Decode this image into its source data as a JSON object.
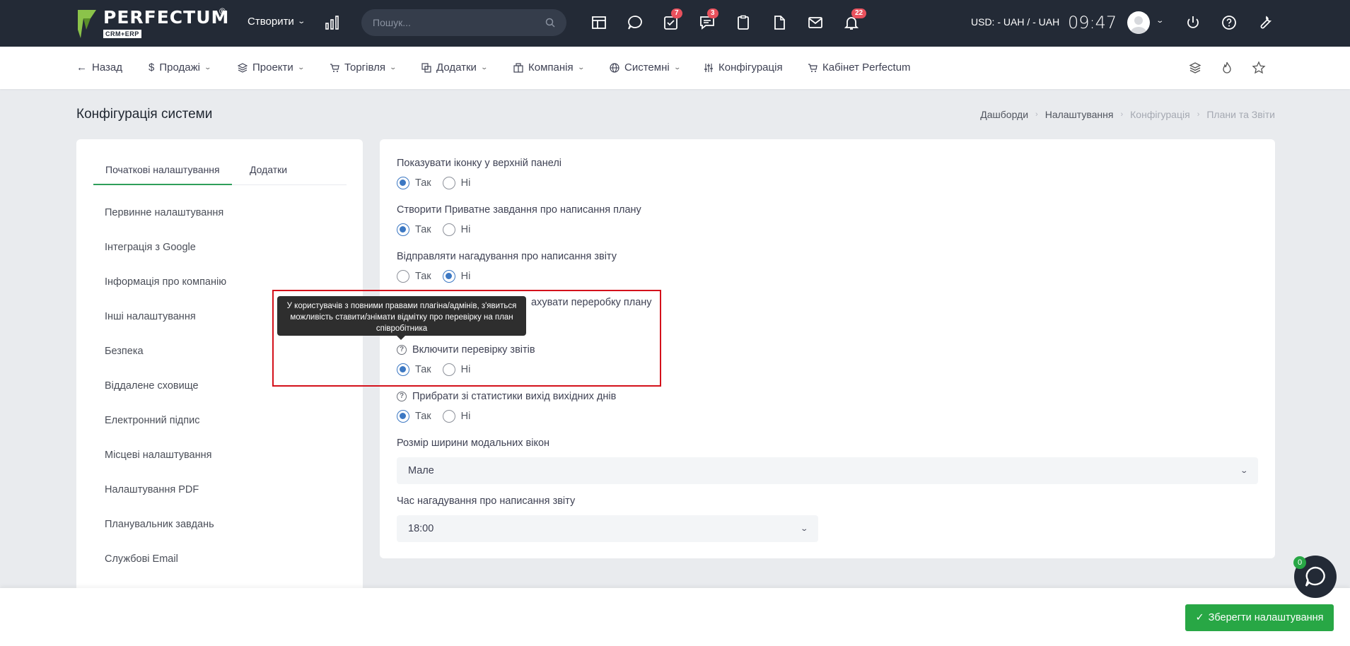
{
  "topbar": {
    "logo_word": "PERFECTUM",
    "logo_reg": "®",
    "logo_sub": "CRM+ERP",
    "create_label": "Створити",
    "search_placeholder": "Пошук...",
    "badges": {
      "tasks": "7",
      "messages": "3",
      "notifications": "22"
    },
    "currency": "USD: - UAH / - UAH",
    "time": "09:47"
  },
  "nav": {
    "back": "Назад",
    "sales": "Продажі",
    "projects": "Проекти",
    "trade": "Торгівля",
    "addons": "Додатки",
    "company": "Компанія",
    "system": "Системні",
    "config": "Конфігурація",
    "cabinet": "Кабінет Perfectum"
  },
  "page": {
    "title": "Конфігурація системи",
    "breadcrumb": [
      "Дашборди",
      "Налаштування",
      "Конфігурація",
      "Плани та Звіти"
    ]
  },
  "left": {
    "tabs": [
      "Початкові налаштування",
      "Додатки"
    ],
    "menu": [
      "Первинне налаштування",
      "Інтеграція з Google",
      "Інформація про компанію",
      "Інші налаштування",
      "Безпека",
      "Віддалене сховище",
      "Електронний підпис",
      "Місцеві налаштування",
      "Налаштування PDF",
      "Планувальник завдань",
      "Службові Email"
    ]
  },
  "settings": {
    "yes": "Так",
    "no": "Ні",
    "show_icon": "Показувати іконку у верхній панелі",
    "create_task": "Створити Приватне завдання про написання плану",
    "send_reminder": "Відправляти нагадування про написання звіту",
    "overtime_partial": "ахувати переробку плану",
    "enable_check": "Включити перевірку звітів",
    "remove_weekends": "Прибрати зі статистики вихід вихідних днів",
    "modal_width_label": "Розмір ширини модальних вікон",
    "modal_width_value": "Мале",
    "reminder_time_label": "Час нагадування про написання звіту",
    "reminder_time_value": "18:00"
  },
  "tooltip": {
    "text": "У користувачів з повними правами плагіна/адмінів, з'явиться можливість ставити/знімати відмітку про перевірку на план співробітника"
  },
  "footer": {
    "save_label": "Зберегти налаштування",
    "chat_badge": "0"
  },
  "colors": {
    "topbar": "#232a36",
    "accent_green": "#28a745",
    "radio_blue": "#3c78c3",
    "highlight_red": "#d4111b",
    "badge_red": "#e8515d"
  }
}
